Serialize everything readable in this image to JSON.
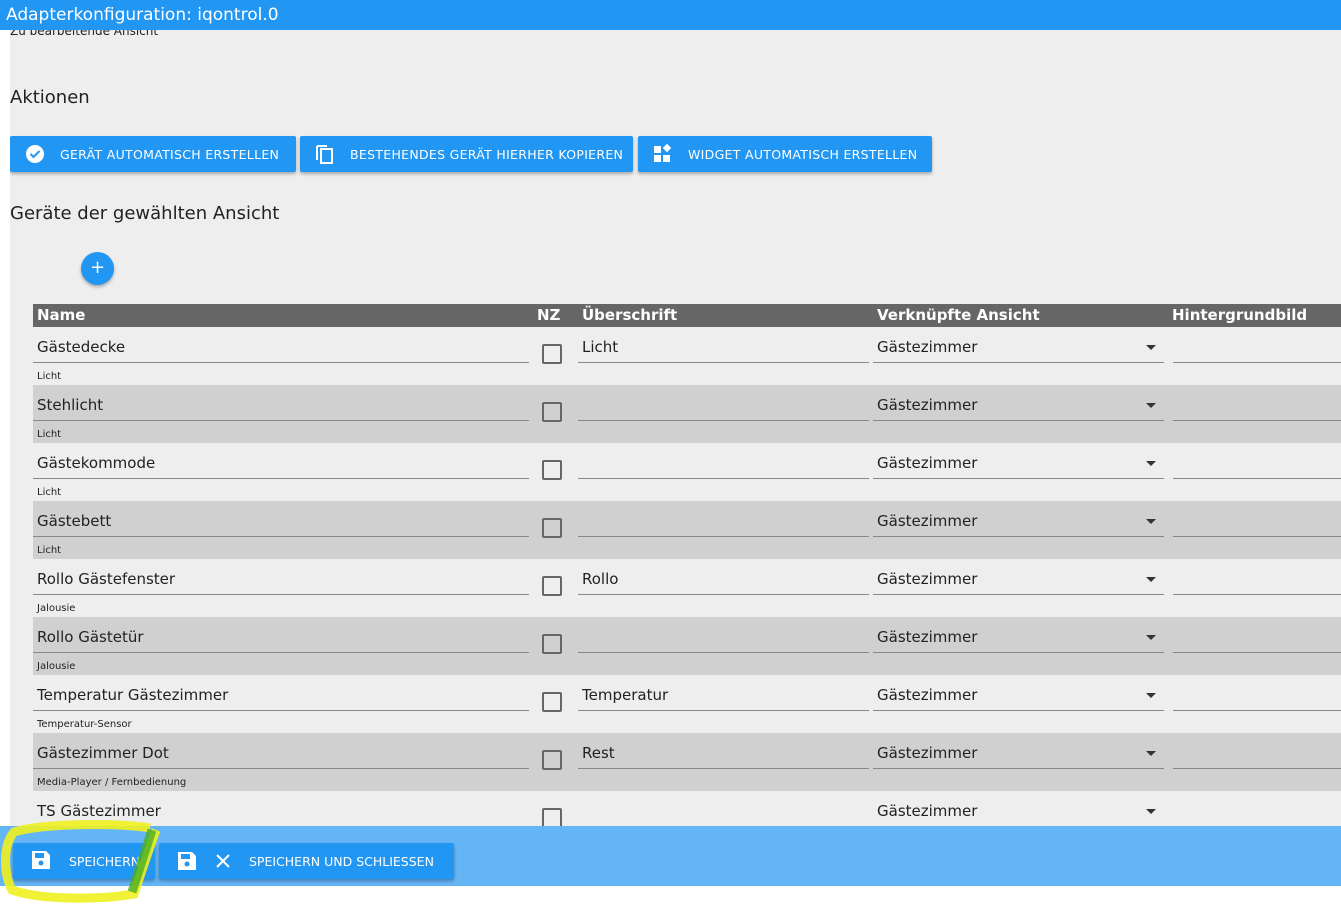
{
  "title": "Adapterkonfiguration: iqontrol.0",
  "subtitle": "Zu bearbeitende Ansicht",
  "actions_heading": "Aktionen",
  "actions": [
    {
      "label": "GERÄT AUTOMATISCH ERSTELLEN",
      "icon": "check-circle-icon"
    },
    {
      "label": "BESTEHENDES GERÄT HIERHER KOPIEREN",
      "icon": "copy-icon"
    },
    {
      "label": "WIDGET AUTOMATISCH ERSTELLEN",
      "icon": "widgets-icon"
    }
  ],
  "devices_heading": "Geräte der gewählten Ansicht",
  "add_label": "+",
  "columns": [
    "Name",
    "NZ",
    "Überschrift",
    "Verknüpfte Ansicht",
    "Hintergrundbild"
  ],
  "rows": [
    {
      "name": "Gästedecke",
      "type": "Licht",
      "heading": "Licht",
      "view": "Gästezimmer",
      "nz": false
    },
    {
      "name": "Stehlicht",
      "type": "Licht",
      "heading": "",
      "view": "Gästezimmer",
      "nz": false
    },
    {
      "name": "Gästekommode",
      "type": "Licht",
      "heading": "",
      "view": "Gästezimmer",
      "nz": false
    },
    {
      "name": "Gästebett",
      "type": "Licht",
      "heading": "",
      "view": "Gästezimmer",
      "nz": false
    },
    {
      "name": "Rollo Gästefenster",
      "type": "Jalousie",
      "heading": "Rollo",
      "view": "Gästezimmer",
      "nz": false
    },
    {
      "name": "Rollo Gästetür",
      "type": "Jalousie",
      "heading": "",
      "view": "Gästezimmer",
      "nz": false
    },
    {
      "name": "Temperatur Gästezimmer",
      "type": "Temperatur-Sensor",
      "heading": "Temperatur",
      "view": "Gästezimmer",
      "nz": false
    },
    {
      "name": "Gästezimmer Dot",
      "type": "Media-Player / Fernbedienung",
      "heading": "Rest",
      "view": "Gästezimmer",
      "nz": false
    },
    {
      "name": "TS Gästezimmer",
      "type": "",
      "heading": "",
      "view": "Gästezimmer",
      "nz": false
    }
  ],
  "footer": {
    "save": "SPEICHERN",
    "save_close": "SPEICHERN UND SCHLIESSEN"
  },
  "colors": {
    "primary": "#2196f3",
    "footer": "#64b5f6",
    "highlight": "#f0f020"
  }
}
